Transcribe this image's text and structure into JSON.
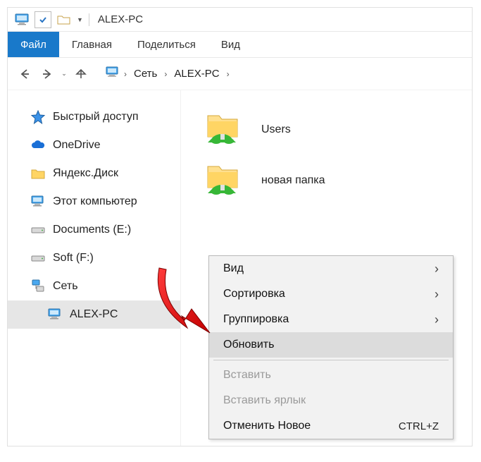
{
  "title": "ALEX-PC",
  "ribbon": {
    "file": "Файл",
    "home": "Главная",
    "share": "Поделиться",
    "view": "Вид"
  },
  "breadcrumb": {
    "root": "Сеть",
    "pc": "ALEX-PC"
  },
  "sidebar": {
    "quick": "Быстрый доступ",
    "onedrive": "OneDrive",
    "yandex": "Яндекс.Диск",
    "thispc": "Этот компьютер",
    "docs": "Documents (E:)",
    "soft": "Soft (F:)",
    "network": "Сеть",
    "alexpc": "ALEX-PC"
  },
  "content": {
    "users": "Users",
    "newfolder": "новая папка"
  },
  "ctx": {
    "view": "Вид",
    "sort": "Сортировка",
    "group": "Группировка",
    "refresh": "Обновить",
    "paste": "Вставить",
    "pastelnk": "Вставить ярлык",
    "undo": "Отменить Новое",
    "undo_short": "CTRL+Z"
  }
}
